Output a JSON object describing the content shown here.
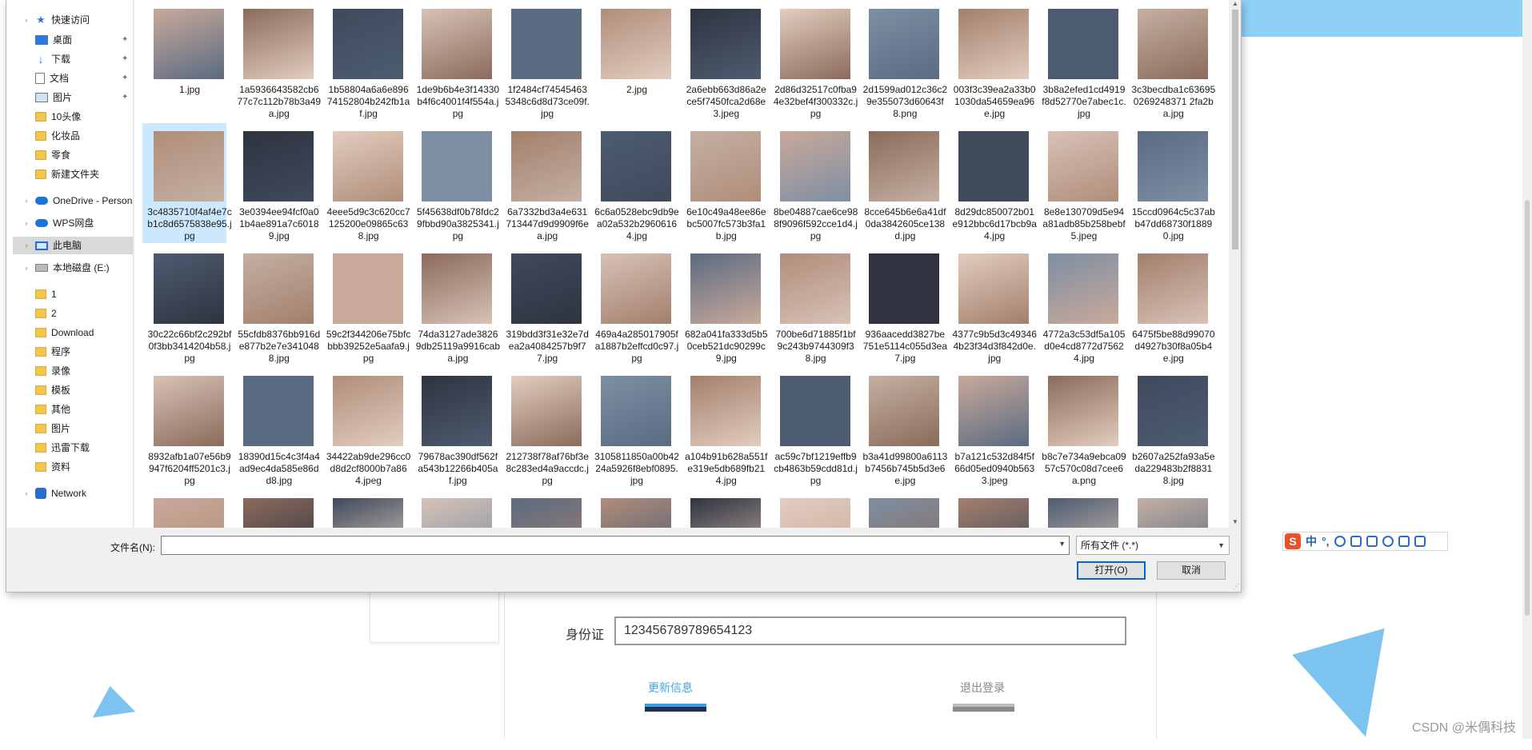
{
  "page": {
    "id_label": "身份证",
    "id_value": "123456789789654123",
    "update_btn": "更新信息",
    "logout_btn": "退出登录",
    "watermark": "CSDN @米偶科技"
  },
  "ime": {
    "logo": "S",
    "lang": "中",
    "punct": "°,"
  },
  "dialog": {
    "nav": [
      {
        "label": "快速访问",
        "icon": "star-icon",
        "type": "section"
      },
      {
        "label": "桌面",
        "icon": "desktop-icon",
        "pinned": true
      },
      {
        "label": "下载",
        "icon": "download-icon",
        "pinned": true
      },
      {
        "label": "文档",
        "icon": "document-icon",
        "pinned": true
      },
      {
        "label": "图片",
        "icon": "picture-icon",
        "pinned": true
      },
      {
        "label": "10头像",
        "icon": "folder-icon"
      },
      {
        "label": "化妆品",
        "icon": "folder-icon"
      },
      {
        "label": "零食",
        "icon": "folder-icon"
      },
      {
        "label": "新建文件夹",
        "icon": "folder-icon"
      },
      {
        "label": "OneDrive - Persona",
        "icon": "onedrive-icon",
        "type": "section"
      },
      {
        "label": "WPS网盘",
        "icon": "wps-cloud-icon",
        "type": "section"
      },
      {
        "label": "此电脑",
        "icon": "computer-icon",
        "type": "section",
        "selected": true
      },
      {
        "label": "本地磁盘 (E:)",
        "icon": "disk-icon",
        "type": "section"
      },
      {
        "label": "1",
        "icon": "folder-icon"
      },
      {
        "label": "2",
        "icon": "folder-icon"
      },
      {
        "label": "Download",
        "icon": "folder-icon"
      },
      {
        "label": "程序",
        "icon": "folder-icon"
      },
      {
        "label": "录像",
        "icon": "folder-icon"
      },
      {
        "label": "模板",
        "icon": "folder-icon"
      },
      {
        "label": "其他",
        "icon": "folder-icon"
      },
      {
        "label": "图片",
        "icon": "folder-icon"
      },
      {
        "label": "迅雷下载",
        "icon": "folder-icon"
      },
      {
        "label": "资料",
        "icon": "folder-icon"
      },
      {
        "label": "Network",
        "icon": "network-icon",
        "type": "section"
      }
    ],
    "files": [
      [
        "1.jpg",
        "1a5936643582cb677c7c112b78b3a49a.jpg",
        "1b58804a6a6e89674152804b242fb1af.jpg",
        "1de9b6b4e3f14330b4f6c4001f4f554a.jpg",
        "1f2484cf745454635348c6d8d73ce09f.jpg",
        "2.jpg",
        "2a6ebb663d86a2ece5f7450fca2d68e3.jpeg",
        "2d86d32517c0fba94e32bef4f300332c.jpg",
        "2d1599ad012c36c29e355073d60643f8.png",
        "003f3c39ea2a33b01030da54659ea96e.jpg",
        "3b8a2efed1cd4919f8d52770e7abec1c.jpg",
        "3c3becdba1c636950269248371 2fa2ba.jpg"
      ],
      [
        "3c4835710f4af4e7cb1c8d6575838e95.jpg",
        "3e0394ee94fcf0a01b4ae891a7c60189.jpg",
        "4eee5d9c3c620cc7125200e09865c638.jpg",
        "5f45638df0b78fdc29fbbd90a3825341.jpg",
        "6a7332bd3a4e631713447d9d9909f6ea.jpg",
        "6c6a0528ebc9db9ea02a532b29606164.jpg",
        "6e10c49a48ee86ebc5007fc573b3fa1b.jpg",
        "8be04887cae6ce988f9096f592cce1d4.jpg",
        "8cce645b6e6a41df0da3842605ce138d.jpg",
        "8d29dc850072b01e912bbc6d17bcb9a4.jpg",
        "8e8e130709d5e94a81adb85b258bebf5.jpeg",
        "15ccd0964c5c37abb47dd68730f18890.jpg"
      ],
      [
        "30c22c66bf2c292bf0f3bb3414204b58.jpg",
        "55cfdb8376bb916de877b2e7e3410488.jpg",
        "59c2f344206e75bfcbbb39252e5aafa9.jpg",
        "74da3127ade38269db25119a9916caba.jpg",
        "319bdd3f31e32e7dea2a4084257b9f77.jpg",
        "469a4a285017905fa1887b2effcd0c97.jpg",
        "682a041fa333d5b50ceb521dc90299c9.jpg",
        "700be6d71885f1bf9c243b9744309f38.jpg",
        "936aacedd3827be751e5114c055d3ea7.jpg",
        "4377c9b5d3c493464b23f34d3f842d0e.jpg",
        "4772a3c53df5a105d0e4cd8772d75624.jpg",
        "6475f5be88d99070d4927b30f8a05b4e.jpg"
      ],
      [
        "8932afb1a07e56b9947f6204ff5201c3.jpg",
        "18390d15c4c3f4a4ad9ec4da585e86dd8.jpg",
        "34422ab9de296cc0d8d2cf8000b7a864.jpeg",
        "79678ac390df562fa543b12266b405af.jpg",
        "212738f78af76bf3e8c283ed4a9accdc.jpg",
        "3105811850a00b4224a5926f8ebf0895.jpg",
        "a104b91b628a551fe319e5db689fb214.jpg",
        "ac59c7bf1219effb9cb4863b59cdd81d.jpg",
        "b3a41d99800a6113b7456b745b5d3e6e.jpg",
        "b7a121c532d84f5f66d05ed0940b5633.jpeg",
        "b8c7e734a9ebca0957c570c08d7cee6a.png",
        "b2607a252fa93a5eda229483b2f88318.jpg"
      ]
    ],
    "filename_label": "文件名(N):",
    "filename_value": "",
    "filetype": "所有文件 (*.*)",
    "open_btn": "打开(O)",
    "cancel_btn": "取消"
  }
}
